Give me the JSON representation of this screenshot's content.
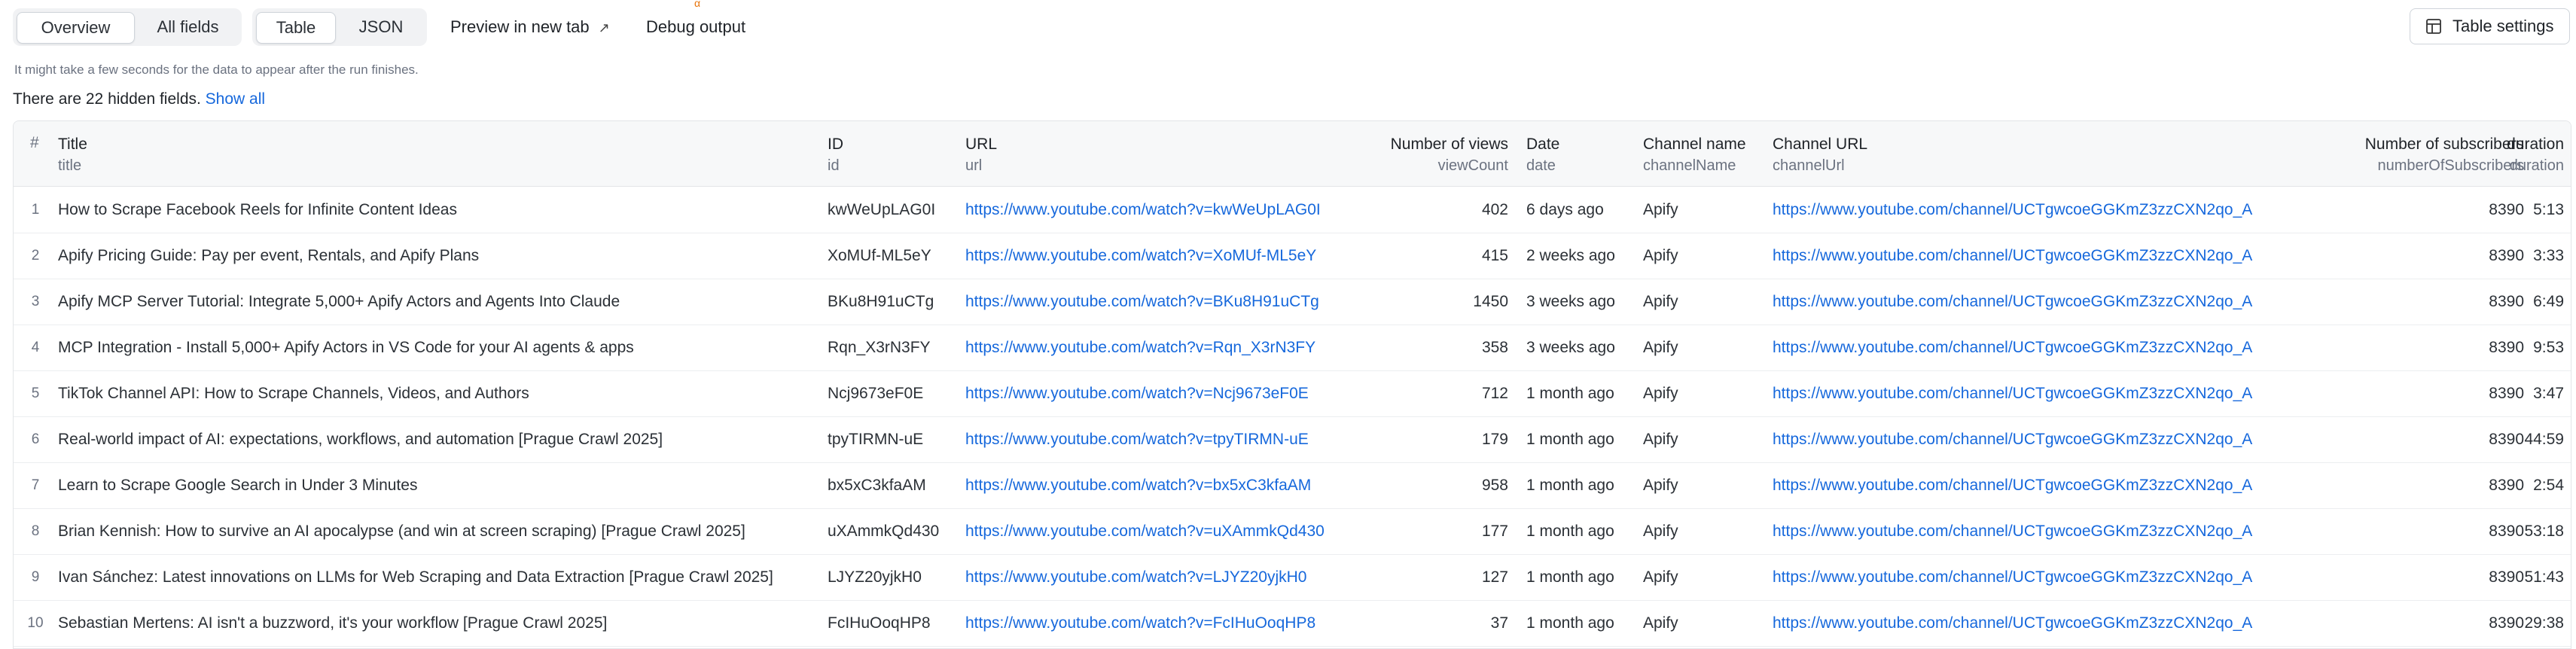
{
  "toolbar": {
    "view_tabs": [
      "Overview",
      "All fields"
    ],
    "format_tabs": [
      "Table",
      "JSON"
    ],
    "preview_label": "Preview in new tab",
    "preview_icon": "external-link-arrow-icon",
    "debug_label": "Debug output",
    "debug_badge": "α",
    "settings_label": "Table settings",
    "settings_icon": "table-icon"
  },
  "notice": "It might take a few seconds for the data to appear after the run finishes.",
  "hidden_fields": {
    "text": "There are 22 hidden fields.",
    "link": "Show all"
  },
  "table": {
    "hash": "#",
    "columns": [
      {
        "title": "Title",
        "key": "title"
      },
      {
        "title": "ID",
        "key": "id"
      },
      {
        "title": "URL",
        "key": "url"
      },
      {
        "title": "Number of views",
        "key": "viewCount"
      },
      {
        "title": "Date",
        "key": "date"
      },
      {
        "title": "Channel name",
        "key": "channelName"
      },
      {
        "title": "Channel URL",
        "key": "channelUrl"
      },
      {
        "title": "Number of subscribers",
        "key": "numberOfSubscribers"
      },
      {
        "title": "duration",
        "key": "duration"
      }
    ],
    "rows": [
      {
        "n": "1",
        "title": "How to Scrape Facebook Reels for Infinite Content Ideas",
        "id": "kwWeUpLAG0I",
        "url": "https://www.youtube.com/watch?v=kwWeUpLAG0I",
        "views": "402",
        "date": "6 days ago",
        "channel": "Apify",
        "channelUrl": "https://www.youtube.com/channel/UCTgwcoeGGKmZ3zzCXN2qo_A",
        "subs": "8390",
        "duration": "5:13"
      },
      {
        "n": "2",
        "title": "Apify Pricing Guide: Pay per event, Rentals, and Apify Plans",
        "id": "XoMUf-ML5eY",
        "url": "https://www.youtube.com/watch?v=XoMUf-ML5eY",
        "views": "415",
        "date": "2 weeks ago",
        "channel": "Apify",
        "channelUrl": "https://www.youtube.com/channel/UCTgwcoeGGKmZ3zzCXN2qo_A",
        "subs": "8390",
        "duration": "3:33"
      },
      {
        "n": "3",
        "title": "Apify MCP Server Tutorial: Integrate 5,000+ Apify Actors and Agents Into Claude",
        "id": "BKu8H91uCTg",
        "url": "https://www.youtube.com/watch?v=BKu8H91uCTg",
        "views": "1450",
        "date": "3 weeks ago",
        "channel": "Apify",
        "channelUrl": "https://www.youtube.com/channel/UCTgwcoeGGKmZ3zzCXN2qo_A",
        "subs": "8390",
        "duration": "6:49"
      },
      {
        "n": "4",
        "title": "MCP Integration - Install 5,000+ Apify Actors in VS Code for your AI agents & apps",
        "id": "Rqn_X3rN3FY",
        "url": "https://www.youtube.com/watch?v=Rqn_X3rN3FY",
        "views": "358",
        "date": "3 weeks ago",
        "channel": "Apify",
        "channelUrl": "https://www.youtube.com/channel/UCTgwcoeGGKmZ3zzCXN2qo_A",
        "subs": "8390",
        "duration": "9:53"
      },
      {
        "n": "5",
        "title": "TikTok Channel API: How to Scrape Channels, Videos, and Authors",
        "id": "Ncj9673eF0E",
        "url": "https://www.youtube.com/watch?v=Ncj9673eF0E",
        "views": "712",
        "date": "1 month ago",
        "channel": "Apify",
        "channelUrl": "https://www.youtube.com/channel/UCTgwcoeGGKmZ3zzCXN2qo_A",
        "subs": "8390",
        "duration": "3:47"
      },
      {
        "n": "6",
        "title": "Real-world impact of AI: expectations, workflows, and automation [Prague Crawl 2025]",
        "id": "tpyTIRMN-uE",
        "url": "https://www.youtube.com/watch?v=tpyTIRMN-uE",
        "views": "179",
        "date": "1 month ago",
        "channel": "Apify",
        "channelUrl": "https://www.youtube.com/channel/UCTgwcoeGGKmZ3zzCXN2qo_A",
        "subs": "8390",
        "duration": "44:59"
      },
      {
        "n": "7",
        "title": "Learn to Scrape Google Search in Under 3 Minutes",
        "id": "bx5xC3kfaAM",
        "url": "https://www.youtube.com/watch?v=bx5xC3kfaAM",
        "views": "958",
        "date": "1 month ago",
        "channel": "Apify",
        "channelUrl": "https://www.youtube.com/channel/UCTgwcoeGGKmZ3zzCXN2qo_A",
        "subs": "8390",
        "duration": "2:54"
      },
      {
        "n": "8",
        "title": "Brian Kennish: How to survive an AI apocalypse (and win at screen scraping) [Prague Crawl 2025]",
        "id": "uXAmmkQd430",
        "url": "https://www.youtube.com/watch?v=uXAmmkQd430",
        "views": "177",
        "date": "1 month ago",
        "channel": "Apify",
        "channelUrl": "https://www.youtube.com/channel/UCTgwcoeGGKmZ3zzCXN2qo_A",
        "subs": "8390",
        "duration": "53:18"
      },
      {
        "n": "9",
        "title": "Ivan Sánchez: Latest innovations on LLMs for Web Scraping and Data Extraction [Prague Crawl 2025]",
        "id": "LJYZ20yjkH0",
        "url": "https://www.youtube.com/watch?v=LJYZ20yjkH0",
        "views": "127",
        "date": "1 month ago",
        "channel": "Apify",
        "channelUrl": "https://www.youtube.com/channel/UCTgwcoeGGKmZ3zzCXN2qo_A",
        "subs": "8390",
        "duration": "51:43"
      },
      {
        "n": "10",
        "title": "Sebastian Mertens: AI isn't a buzzword, it's your workflow [Prague Crawl 2025]",
        "id": "FcIHuOoqHP8",
        "url": "https://www.youtube.com/watch?v=FcIHuOoqHP8",
        "views": "37",
        "date": "1 month ago",
        "channel": "Apify",
        "channelUrl": "https://www.youtube.com/channel/UCTgwcoeGGKmZ3zzCXN2qo_A",
        "subs": "8390",
        "duration": "29:38"
      }
    ]
  },
  "colors": {
    "link": "#1668dc",
    "badge": "#e8740b"
  }
}
